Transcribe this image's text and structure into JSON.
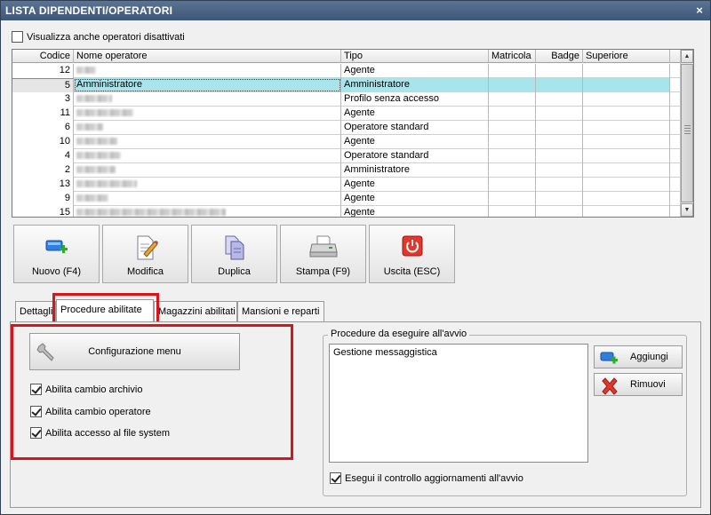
{
  "window": {
    "title": "LISTA DIPENDENTI/OPERATORI",
    "close_glyph": "×"
  },
  "show_disabled": {
    "label": "Visualizza anche operatori disattivati",
    "checked": false
  },
  "grid": {
    "headers": {
      "code": "Codice",
      "name": "Nome operatore",
      "tipo": "Tipo",
      "matricola": "Matricola",
      "badge": "Badge",
      "superiore": "Superiore"
    },
    "rows": [
      {
        "code": "12",
        "name": "",
        "tipo": "Agente",
        "selected": false
      },
      {
        "code": "5",
        "name": "Amministratore",
        "tipo": "Amministratore",
        "selected": true
      },
      {
        "code": "3",
        "name": "",
        "tipo": "Profilo senza accesso",
        "selected": false
      },
      {
        "code": "11",
        "name": "",
        "tipo": "Agente",
        "selected": false
      },
      {
        "code": "6",
        "name": "",
        "tipo": "Operatore standard",
        "selected": false
      },
      {
        "code": "10",
        "name": "",
        "tipo": "Agente",
        "selected": false
      },
      {
        "code": "4",
        "name": "",
        "tipo": "Operatore standard",
        "selected": false
      },
      {
        "code": "2",
        "name": "",
        "tipo": "Amministratore",
        "selected": false
      },
      {
        "code": "13",
        "name": "",
        "tipo": "Agente",
        "selected": false
      },
      {
        "code": "9",
        "name": "",
        "tipo": "Agente",
        "selected": false
      },
      {
        "code": "15",
        "name": "",
        "tipo": "Agente",
        "selected": false
      }
    ]
  },
  "toolbar": {
    "new_label": "Nuovo (F4)",
    "edit_label": "Modifica",
    "duplicate_label": "Duplica",
    "print_label": "Stampa (F9)",
    "exit_label": "Uscita (ESC)"
  },
  "tabs": {
    "details": "Dettagli",
    "procedures": "Procedure abilitate",
    "warehouses": "Magazzini abilitati",
    "roles": "Mansioni e reparti"
  },
  "procedures_tab": {
    "menu_config_label": "Configurazione menu",
    "options": [
      {
        "label": "Abilita cambio archivio",
        "checked": true
      },
      {
        "label": "Abilita cambio operatore",
        "checked": true
      },
      {
        "label": "Abilita accesso al file system",
        "checked": true
      }
    ],
    "startup_group_title": "Procedure da eseguire all'avvio",
    "startup_items": [
      "Gestione messaggistica"
    ],
    "add_label": "Aggiungi",
    "remove_label": "Rimuovi",
    "update_check": {
      "label": "Esegui il controllo aggiornamenti all'avvio",
      "checked": true
    }
  },
  "colors": {
    "title_bar": "#4a6386",
    "selected_row": "#a8e4ea",
    "highlight": "#d8141c"
  }
}
